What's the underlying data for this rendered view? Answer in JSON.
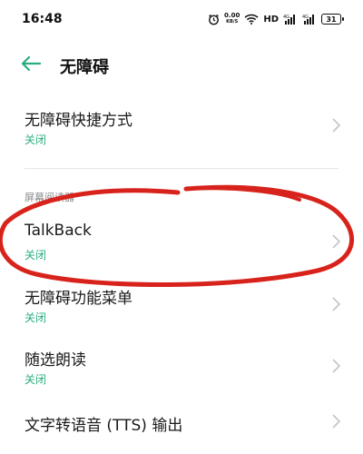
{
  "status_bar": {
    "time": "16:48",
    "net_speed_value": "0.00",
    "net_speed_unit": "KB/S",
    "hd_label": "HD",
    "battery": "31"
  },
  "header": {
    "title": "无障碍"
  },
  "items": [
    {
      "title": "无障碍快捷方式",
      "status": "关闭"
    },
    {
      "title": "TalkBack",
      "status": "关闭"
    },
    {
      "title": "无障碍功能菜单",
      "status": "关闭"
    },
    {
      "title": "随选朗读",
      "status": "关闭"
    },
    {
      "title": "文字转语音 (TTS) 输出",
      "status": ""
    }
  ],
  "section": {
    "screen_reader_label": "屏幕阅读器"
  },
  "colors": {
    "accent": "#2aae7e",
    "annotation": "#d8231c"
  },
  "icons": {
    "back": "arrow-left-icon",
    "chevron": "chevron-right-icon"
  }
}
